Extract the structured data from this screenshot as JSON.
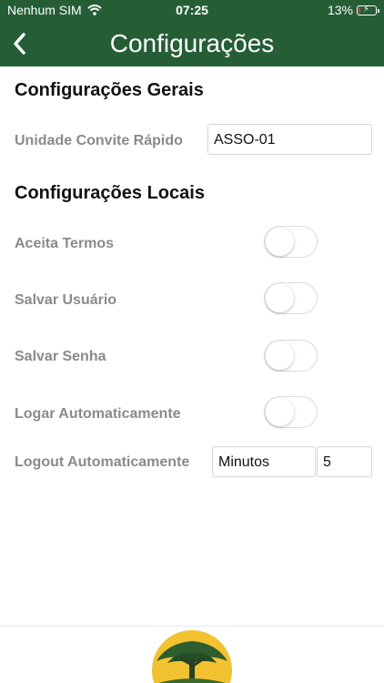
{
  "status_bar": {
    "carrier": "Nenhum SIM",
    "time": "07:25",
    "battery": "13%",
    "battery_level": 0.13
  },
  "header": {
    "title": "Configurações",
    "back_icon": "chevron-left-icon"
  },
  "general": {
    "title": "Configurações Gerais",
    "convite_label": "Unidade Convite Rápido",
    "convite_value": "ASSO-01"
  },
  "local": {
    "title": "Configurações Locais",
    "toggles": [
      {
        "label": "Aceita Termos",
        "on": false
      },
      {
        "label": "Salvar Usuário",
        "on": false
      },
      {
        "label": "Salvar Senha",
        "on": false
      },
      {
        "label": "Logar Automaticamente",
        "on": false
      }
    ],
    "logout_label": "Logout Automaticamente",
    "logout_unit": "Minutos",
    "logout_value": "5"
  },
  "colors": {
    "header_bg": "#255e35",
    "logo_sun": "#f2c230",
    "tree": "#2f5e2e"
  }
}
